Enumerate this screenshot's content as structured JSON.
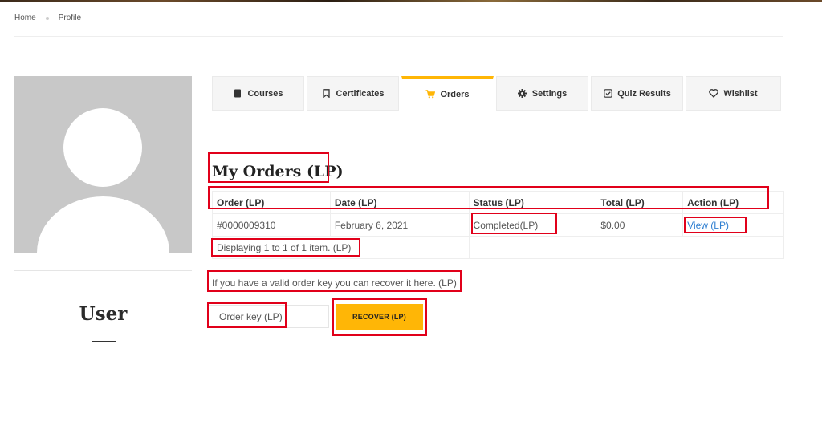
{
  "breadcrumb": {
    "home": "Home",
    "current": "Profile"
  },
  "profile": {
    "name": "User",
    "avatar_icon": "user-avatar-placeholder"
  },
  "tabs": [
    {
      "label": "Courses",
      "icon": "book-icon"
    },
    {
      "label": "Certificates",
      "icon": "bookmark-icon"
    },
    {
      "label": "Orders",
      "icon": "cart-icon",
      "active": true
    },
    {
      "label": "Settings",
      "icon": "gear-icon"
    },
    {
      "label": "Quiz Results",
      "icon": "checkbox-icon"
    },
    {
      "label": "Wishlist",
      "icon": "heart-icon"
    }
  ],
  "orders": {
    "title": "My Orders (LP)",
    "columns": [
      "Order (LP)",
      "Date (LP)",
      "Status (LP)",
      "Total (LP)",
      "Action (LP)"
    ],
    "rows": [
      {
        "order": "#0000009310",
        "date": "February 6, 2021",
        "status": "Completed(LP)",
        "total": "$0.00",
        "action": "View (LP)"
      }
    ],
    "summary": "Displaying 1 to 1 of 1 item. (LP)"
  },
  "recover": {
    "text": "If you have a valid order key you can recover it here. (LP)",
    "placeholder": "Order key (LP)",
    "button": "RECOVER (LP)"
  },
  "colors": {
    "accent": "#ffb606",
    "link": "#2f7fd1",
    "highlight": "#e1001a",
    "avatar_bg": "#c8c8c8"
  }
}
